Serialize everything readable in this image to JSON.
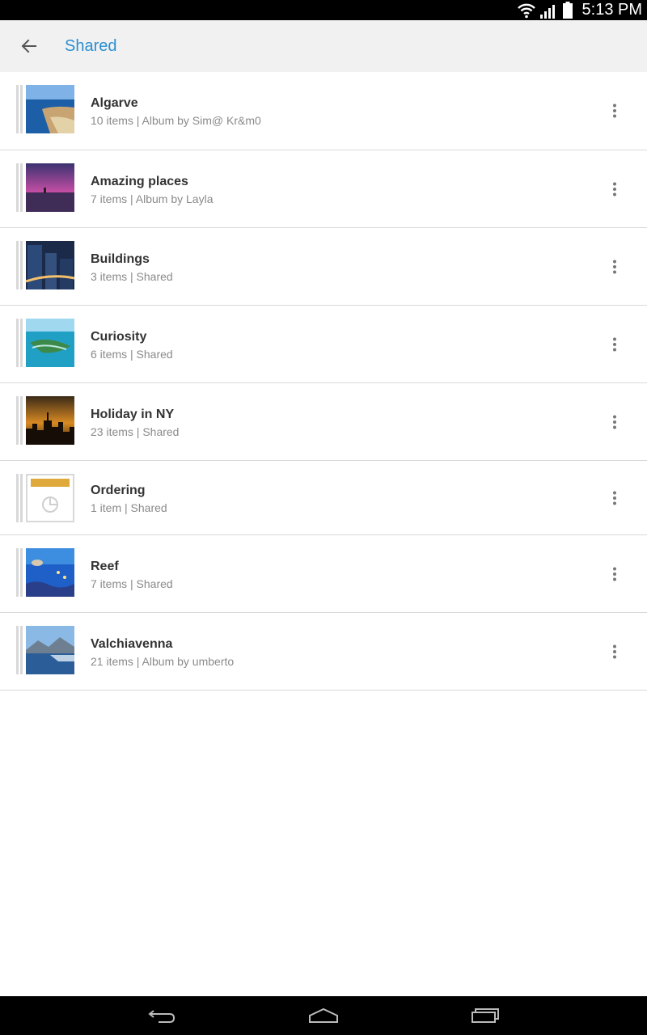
{
  "status_bar": {
    "time": "5:13 PM",
    "icons": [
      "wifi-icon",
      "signal-icon",
      "battery-icon"
    ]
  },
  "action_bar": {
    "title": "Shared",
    "back_icon": "arrow-back-icon"
  },
  "albums": [
    {
      "name": "Algarve",
      "meta": "10 items | Album by Sim@ Kr&m0",
      "thumb": "coastal-cliffs-photo"
    },
    {
      "name": "Amazing places",
      "meta": "7 items | Album by Layla",
      "thumb": "purple-sunset-sea-photo"
    },
    {
      "name": "Buildings",
      "meta": "3 items | Shared",
      "thumb": "night-city-buildings-photo"
    },
    {
      "name": "Curiosity",
      "meta": "6 items | Shared",
      "thumb": "tropical-island-photo"
    },
    {
      "name": "Holiday in NY",
      "meta": "23 items | Shared",
      "thumb": "ny-skyline-sunset-photo"
    },
    {
      "name": "Ordering",
      "meta": "1 item | Shared",
      "thumb": "placeholder-document-icon"
    },
    {
      "name": "Reef",
      "meta": "7 items | Shared",
      "thumb": "coral-reef-photo"
    },
    {
      "name": "Valchiavenna",
      "meta": "21 items | Album by umberto",
      "thumb": "lake-mountains-photo"
    }
  ],
  "nav_bar": {
    "icons": [
      "back-nav-icon",
      "home-nav-icon",
      "recents-nav-icon"
    ]
  },
  "colors": {
    "accent": "#2a8fd1",
    "action_bar_bg": "#f1f1f1",
    "divider": "#d9d9d9"
  }
}
